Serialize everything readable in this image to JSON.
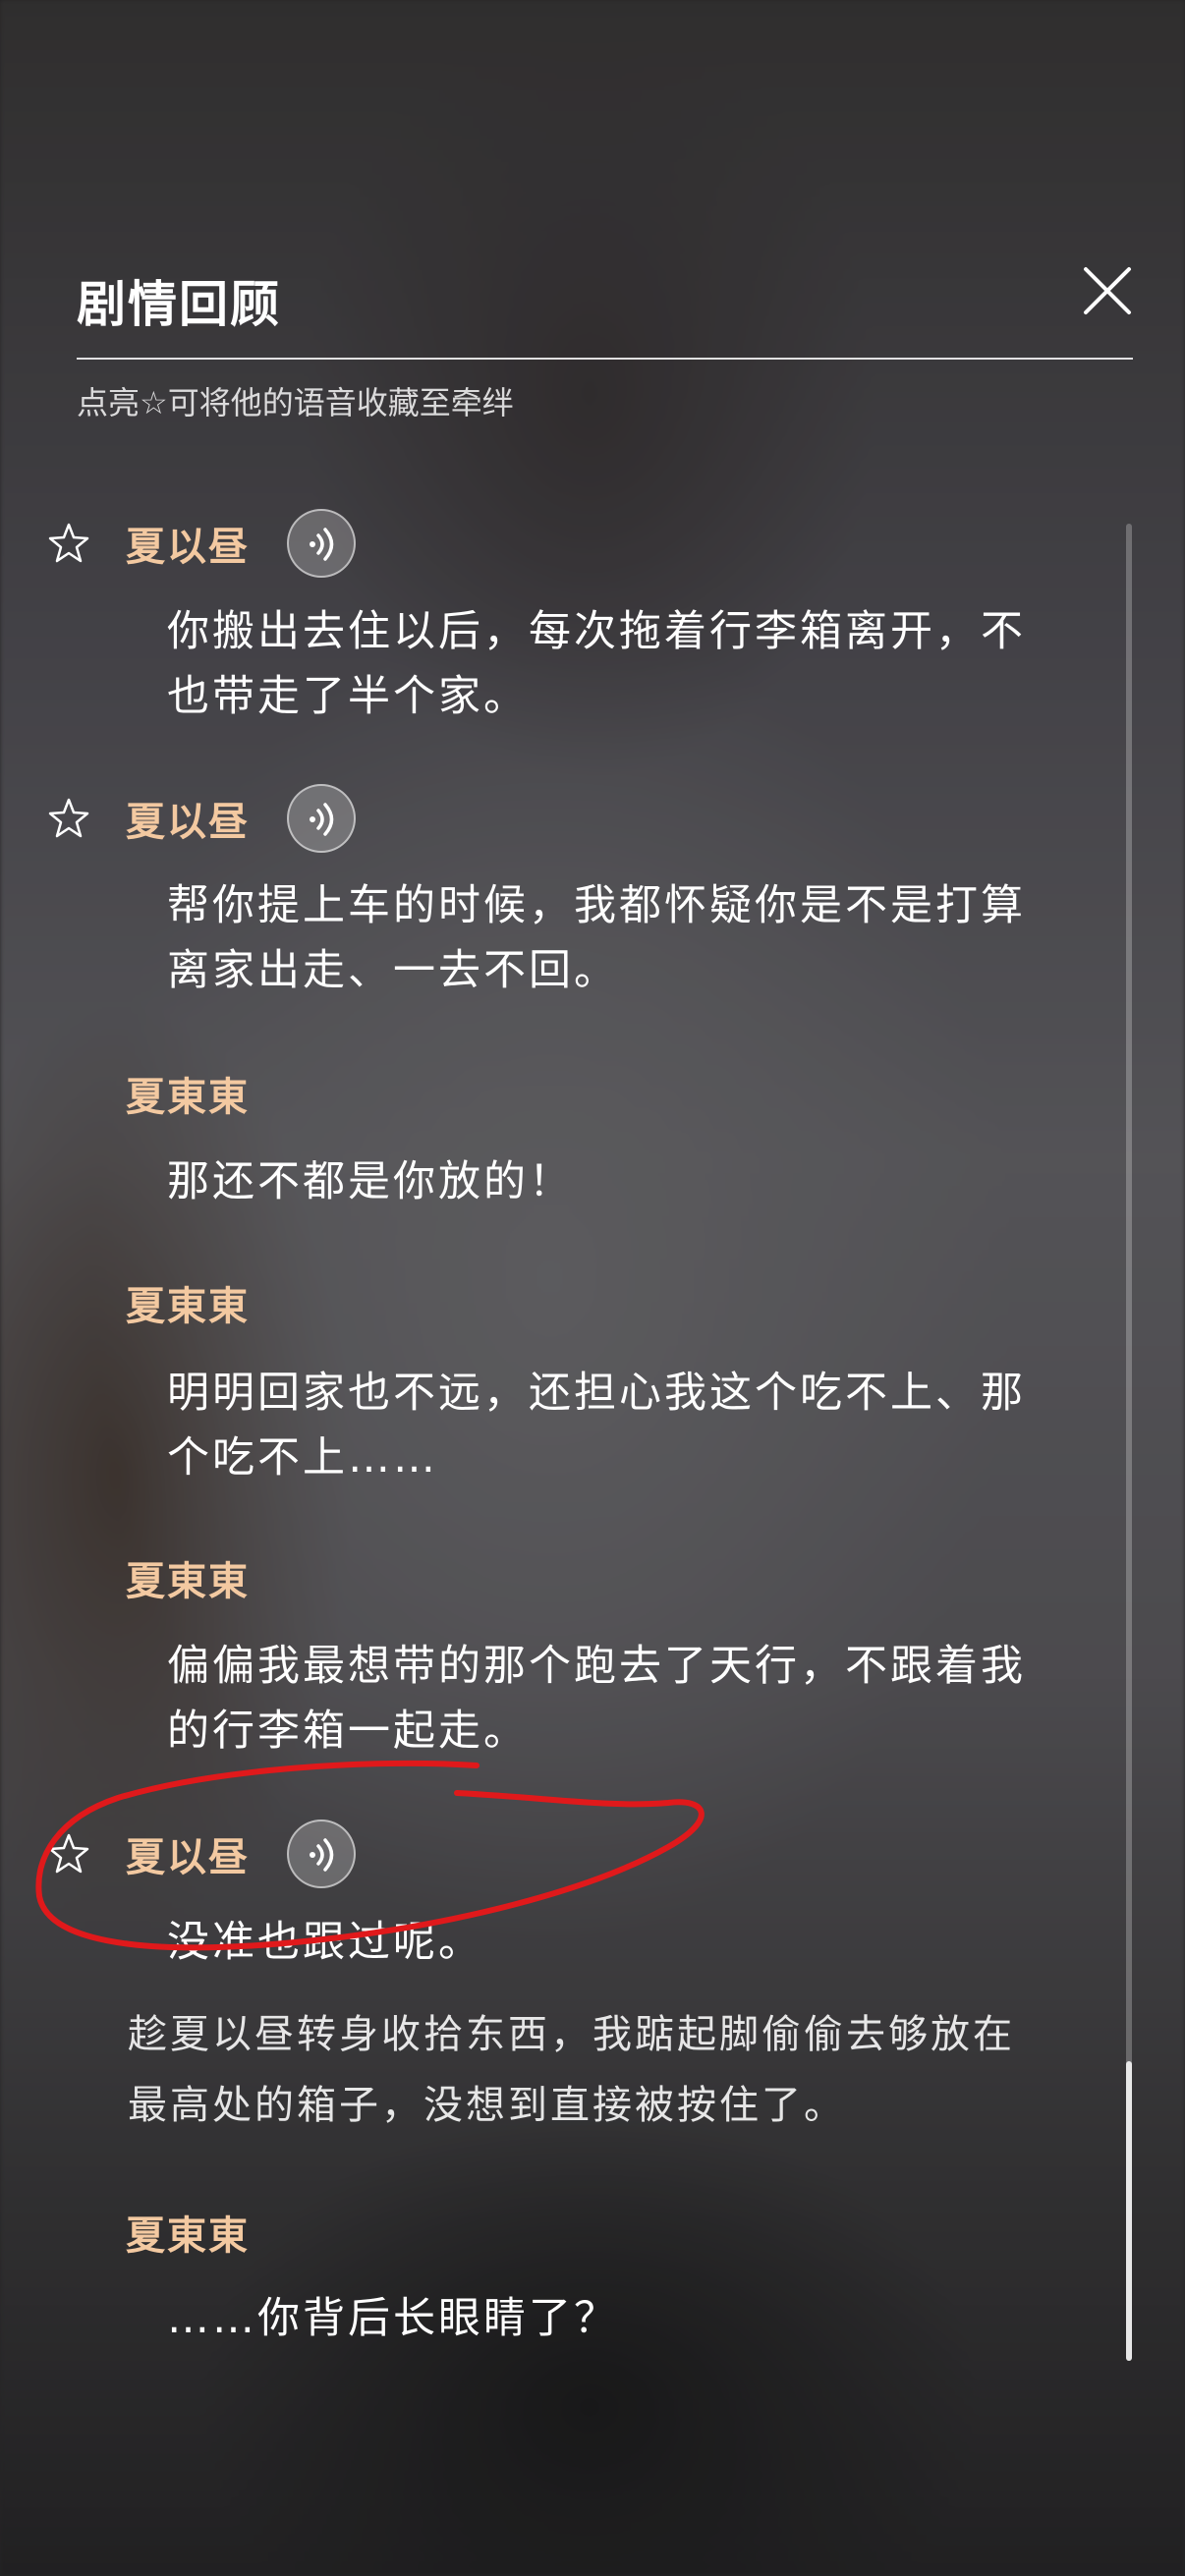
{
  "header": {
    "title": "剧情回顾",
    "hint": "点亮☆可将他的语音收藏至牵绊"
  },
  "entries": [
    {
      "speaker": "夏以昼",
      "has_voice": true,
      "text": "你搬出去住以后，每次拖着行李箱离开，不也带走了半个家。"
    },
    {
      "speaker": "夏以昼",
      "has_voice": true,
      "text": "帮你提上车的时候，我都怀疑你是不是打算离家出走、一去不回。"
    },
    {
      "speaker": "夏東東",
      "has_voice": false,
      "text": "那还不都是你放的！"
    },
    {
      "speaker": "夏東東",
      "has_voice": false,
      "text": "明明回家也不远，还担心我这个吃不上、那个吃不上……"
    },
    {
      "speaker": "夏東東",
      "has_voice": false,
      "text": "偏偏我最想带的那个跑去了天行，不跟着我的行李箱一起走。"
    },
    {
      "speaker": "夏以昼",
      "has_voice": true,
      "text": "没准也跟过呢。"
    },
    {
      "narration": "趁夏以昼转身收拾东西，我踮起脚偷偷去够放在最高处的箱子，没想到直接被按住了。"
    },
    {
      "speaker": "夏東東",
      "has_voice": false,
      "text": "……你背后长眼睛了？"
    }
  ],
  "icons": {
    "close": "close-icon",
    "star": "star-outline-icon",
    "voice": "voice-play-icon"
  },
  "colors": {
    "speaker": "#f3c9a1",
    "text": "#ffffff",
    "annotation": "#e0191b"
  }
}
